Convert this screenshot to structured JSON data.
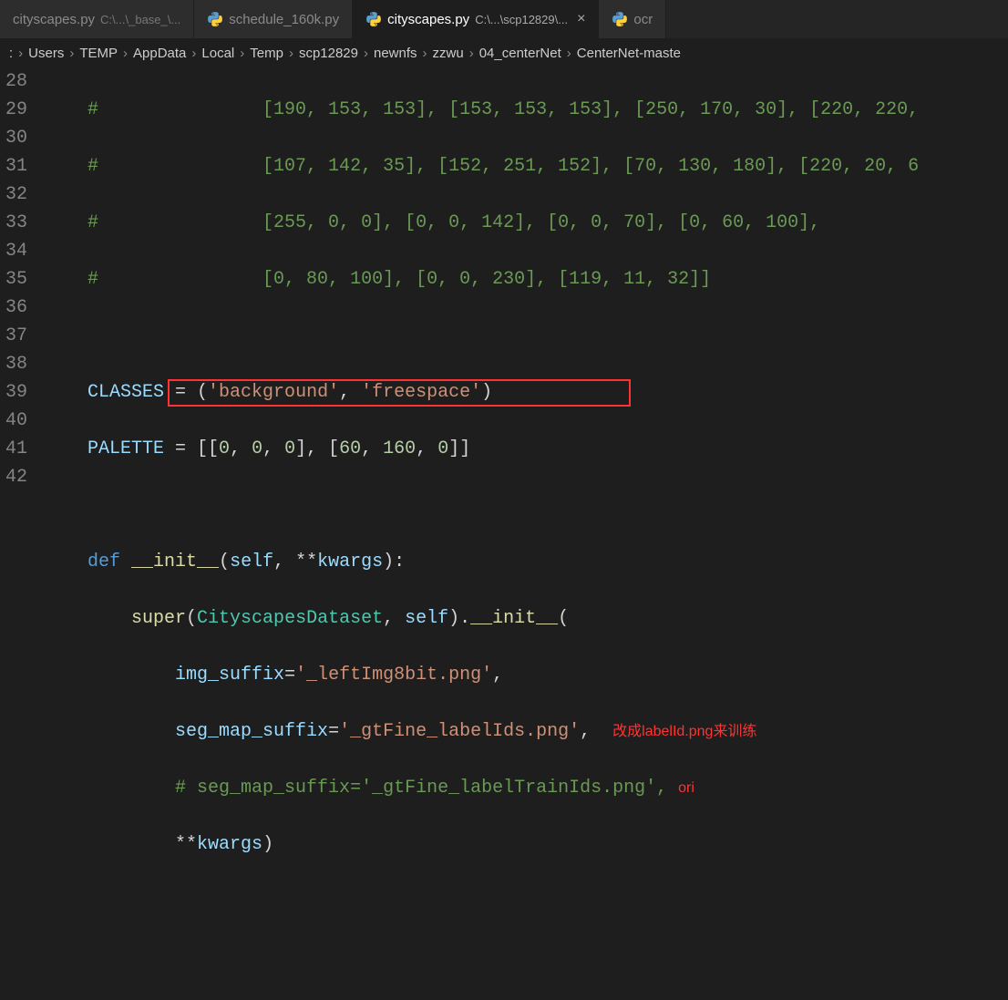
{
  "tabs": [
    {
      "label": "cityscapes.py",
      "detail": "C:\\...\\_base_\\...",
      "active": false,
      "close": false
    },
    {
      "label": "schedule_160k.py",
      "detail": "",
      "active": false,
      "close": false
    },
    {
      "label": "cityscapes.py",
      "detail": "C:\\...\\scp12829\\...",
      "active": true,
      "close": true
    },
    {
      "label": "ocr",
      "detail": "",
      "active": false,
      "close": false
    }
  ],
  "breadcrumb": [
    ":",
    "Users",
    "TEMP",
    "AppData",
    "Local",
    "Temp",
    "scp12829",
    "newnfs",
    "zzwu",
    "04_centerNet",
    "CenterNet-maste"
  ],
  "gutter_lines": [
    "28",
    "29",
    "30",
    "31",
    "32",
    "33",
    "34",
    "35",
    "36",
    "37",
    "38",
    "39",
    "40",
    "41",
    "42"
  ],
  "code": {
    "l28": {
      "prefix": "    #               ",
      "body": "[190, 153, 153], [153, 153, 153], [250, 170, 30], [220, 220,"
    },
    "l29": {
      "prefix": "    #               ",
      "body": "[107, 142, 35], [152, 251, 152], [70, 130, 180], [220, 20, 6"
    },
    "l30": {
      "prefix": "    #               ",
      "body": "[255, 0, 0], [0, 0, 142], [0, 0, 70], [0, 60, 100],"
    },
    "l31": {
      "prefix": "    #               ",
      "body": "[0, 80, 100], [0, 0, 230], [119, 11, 32]]"
    },
    "l33": {
      "classes_kw": "CLASSES",
      "eq": " = (",
      "s1": "'background'",
      "mid": ", ",
      "s2": "'freespace'",
      "end": ")"
    },
    "l34": {
      "palette_kw": "PALETTE",
      "eq": " = [[",
      "n1": "0",
      "n2": "0",
      "n3": "0",
      "mid": "], [",
      "n4": "60",
      "n5": "160",
      "n6": "0",
      "end": "]]"
    },
    "l36": {
      "def": "def ",
      "fn": "__init__",
      "open": "(",
      "self": "self",
      "mid": ", **",
      "kwargs": "kwargs",
      "close": "):"
    },
    "l37": {
      "super": "super",
      "open": "(",
      "cls": "CityscapesDataset",
      "mid": ", ",
      "self": "self",
      "close": ").",
      "init": "__init__",
      "p": "("
    },
    "l38": {
      "arg": "img_suffix",
      "eq": "=",
      "val": "'_leftImg8bit.png'",
      "end": ","
    },
    "l39": {
      "arg": "seg_map_suffix",
      "eq": "=",
      "val": "'_gtFine_labelIds.png'",
      "end": ",",
      "annot": "改成labelId.png来训练"
    },
    "l40": {
      "body": "# seg_map_suffix='_gtFine_labelTrainIds.png', ",
      "annot": "ori"
    },
    "l41": {
      "stars": "**",
      "kwargs": "kwargs",
      "close": ")"
    }
  }
}
